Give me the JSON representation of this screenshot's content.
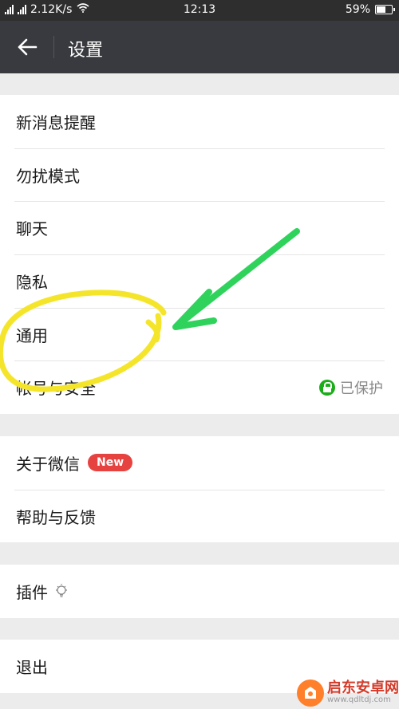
{
  "status_bar": {
    "network_left": "2G",
    "network_right": "4G",
    "speed": "2.12K/s",
    "time": "12:13",
    "battery_percent": "59%",
    "battery_level": 0.59
  },
  "app_bar": {
    "back_icon": "arrow-left-icon",
    "title": "设置"
  },
  "group1": [
    {
      "label": "新消息提醒"
    },
    {
      "label": "勿扰模式"
    },
    {
      "label": "聊天"
    },
    {
      "label": "隐私"
    },
    {
      "label": "通用"
    },
    {
      "label": "帐号与安全",
      "status": "已保护",
      "status_icon": "lock-icon"
    }
  ],
  "group2": [
    {
      "label": "关于微信",
      "badge": "New"
    },
    {
      "label": "帮助与反馈"
    }
  ],
  "group3": [
    {
      "label": "插件",
      "icon": "bulb-icon"
    }
  ],
  "group4": [
    {
      "label": "退出"
    }
  ],
  "colors": {
    "status_bar_bg": "#2e2e2e",
    "app_bar_bg": "#393a3f",
    "page_bg": "#ececec",
    "new_badge": "#e64340",
    "lock_green": "#1aad19",
    "annotation_yellow": "#f5e52a",
    "annotation_green": "#2fd35c"
  },
  "watermark": {
    "brand": "启东安卓网",
    "url": "www.qdltdj.com"
  }
}
